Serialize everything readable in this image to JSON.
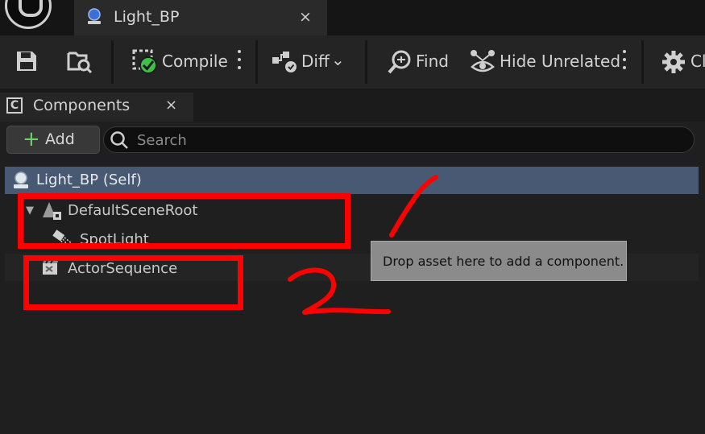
{
  "window": {
    "tab_title": "Light_BP",
    "tab_close": "×"
  },
  "toolbar": {
    "compile_label": "Compile",
    "diff_label": "Diff",
    "find_label": "Find",
    "hide_unrelated_label": "Hide Unrelated",
    "cut_label": "Cl"
  },
  "components_panel": {
    "tab_label": "Components",
    "tab_close": "×",
    "add_label": "Add",
    "search_placeholder": "Search",
    "tree": {
      "self": "Light_BP (Self)",
      "root": "DefaultSceneRoot",
      "child": "SpotLight",
      "sequence": "ActorSequence"
    },
    "tooltip": "Drop asset here to add a component."
  },
  "colors": {
    "selection": "#485a73",
    "annotation": "#ff0000",
    "add_plus": "#6fd06a",
    "compile_ok": "#3fbf4a"
  }
}
